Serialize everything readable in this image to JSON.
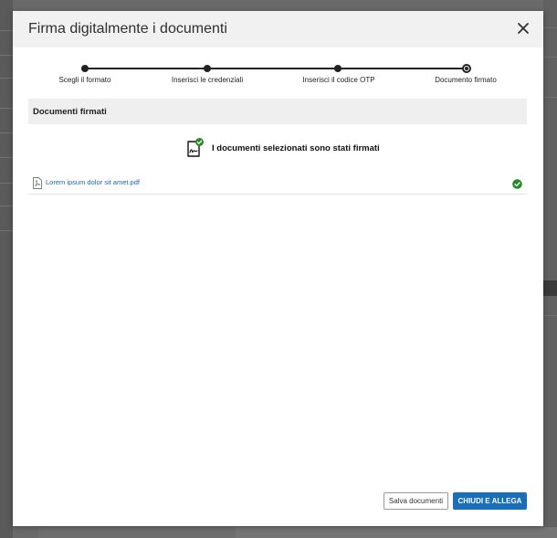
{
  "modal": {
    "title": "Firma digitalmente i documenti",
    "close_icon": "close-icon"
  },
  "stepper": {
    "steps": [
      {
        "label": "Scegli il formato",
        "state": "completed"
      },
      {
        "label": "Inserisci le credenziali",
        "state": "completed"
      },
      {
        "label": "Inserisci il codice OTP",
        "state": "completed"
      },
      {
        "label": "Documento firmato",
        "state": "current"
      }
    ]
  },
  "section": {
    "title": "Documenti firmati"
  },
  "status": {
    "message": "I documenti selezionati sono stati firmati",
    "icon": "signed-document-icon"
  },
  "files": [
    {
      "name": "Lorem ipsum dolor sit amet.pdf",
      "icon": "pdf-file-icon",
      "status_icon": "check-circle-icon",
      "status_color": "#2a8a2a"
    }
  ],
  "footer": {
    "save_label": "Salva documenti",
    "primary_label": "CHIUDI E ALLEGA"
  },
  "colors": {
    "accent": "#1a6fba",
    "success": "#2a8a2a",
    "link": "#1c64b8"
  }
}
